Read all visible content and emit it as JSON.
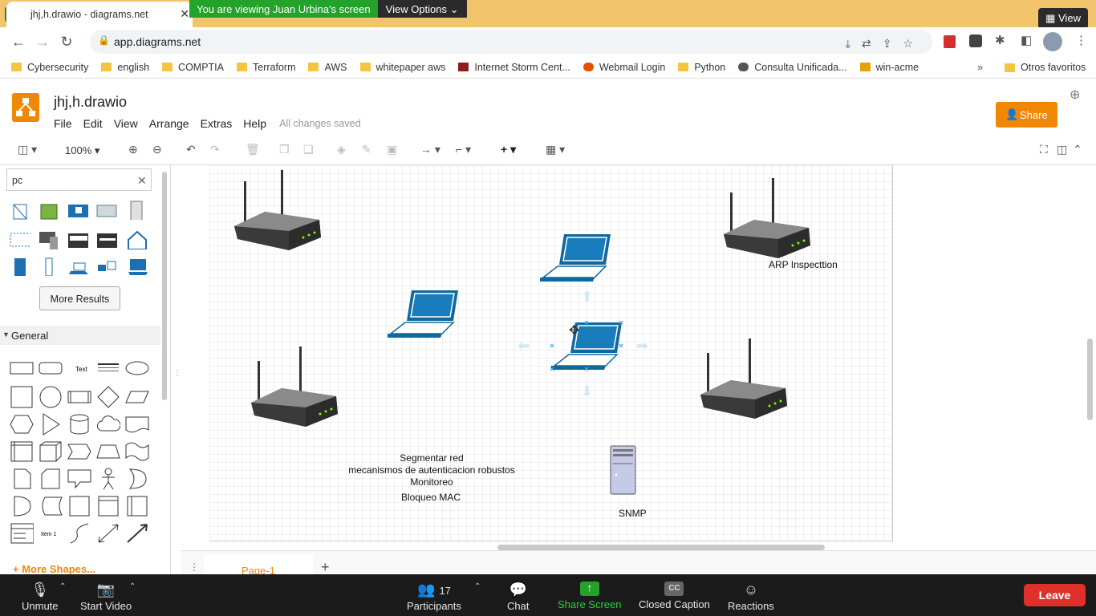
{
  "browser": {
    "tab_title": "jhj,h.drawio - diagrams.net",
    "share_banner": "You are viewing Juan Urbina's screen",
    "view_options": "View Options",
    "view_label": "View",
    "url": "app.diagrams.net"
  },
  "bookmarks": [
    "Cybersecurity",
    "english",
    "COMPTIA",
    "Terraform",
    "AWS",
    "whitepaper aws",
    "Internet Storm Cent...",
    "Webmail Login",
    "Python",
    "Consulta Unificada...",
    "win-acme"
  ],
  "other_bookmarks": "Otros favoritos",
  "app": {
    "file_name": "jhj,h.drawio",
    "menu": [
      "File",
      "Edit",
      "View",
      "Arrange",
      "Extras",
      "Help"
    ],
    "save_status": "All changes saved",
    "share_label": "Share",
    "zoom": "100%"
  },
  "sidebar": {
    "search_value": "pc",
    "more_results": "More Results",
    "general_section": "General",
    "more_shapes": "More Shapes..."
  },
  "canvas": {
    "labels": {
      "arp": "ARP Inspecttion",
      "notes": [
        "Segmentar red",
        "mecanismos de autenticacion robustos",
        "Monitoreo"
      ],
      "mac": "Bloqueo MAC",
      "snmp": "SNMP"
    }
  },
  "pages": {
    "current": "Page-1"
  },
  "meeting": {
    "unmute": "Unmute",
    "start_video": "Start Video",
    "participants": "Participants",
    "participants_count": "17",
    "chat": "Chat",
    "share_screen": "Share Screen",
    "closed_caption": "Closed Caption",
    "reactions": "Reactions",
    "leave": "Leave"
  },
  "colors": {
    "accent": "#f08705",
    "device_blue": "#10689e",
    "share_green": "#23a32a",
    "leave_red": "#e0302b"
  }
}
